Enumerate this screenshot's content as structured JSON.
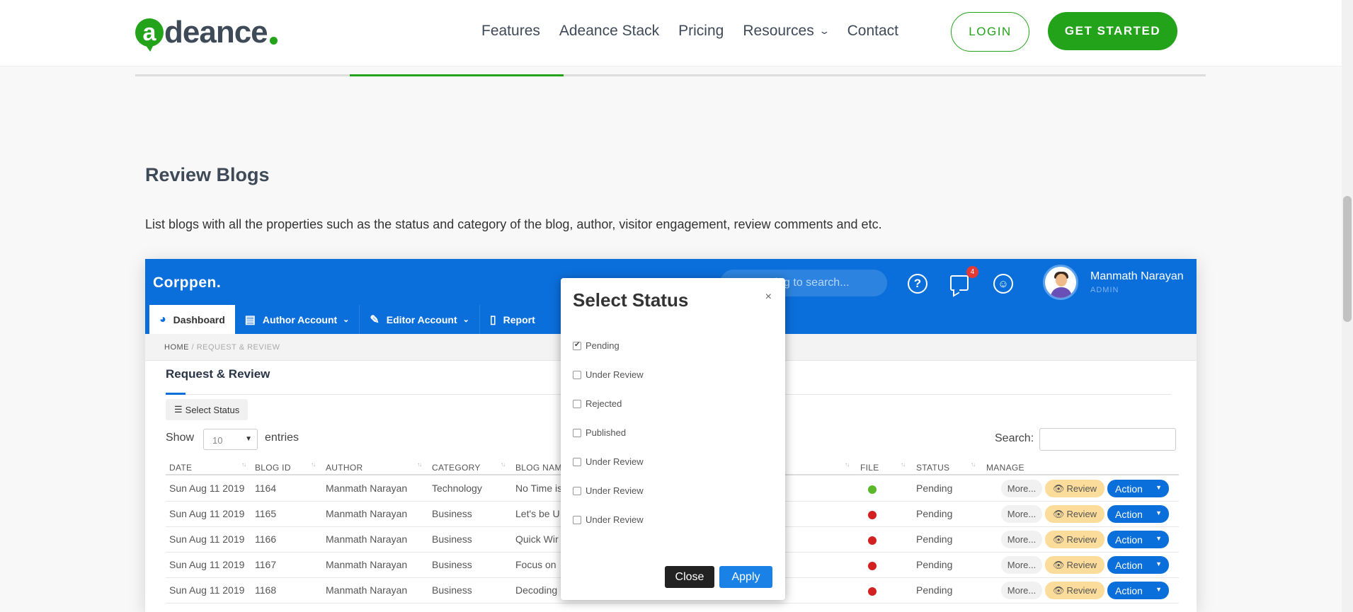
{
  "site": {
    "logo_text": "deance",
    "logo_letter": "a",
    "nav": [
      {
        "label": "Features"
      },
      {
        "label": "Adeance Stack"
      },
      {
        "label": "Pricing"
      },
      {
        "label": "Resources",
        "has_dropdown": true
      },
      {
        "label": "Contact"
      }
    ],
    "login_label": "LOGIN",
    "get_started_label": "GET STARTED",
    "brand_color": "#23a31a"
  },
  "section": {
    "title": "Review Blogs",
    "description": "List blogs with all the properties such as the status and category of the blog, author, visitor engagement, review comments and etc."
  },
  "app": {
    "logo": "Corppen.",
    "search_placeholder": "Start typing to search...",
    "notification_count": "4",
    "user_name": "Manmath Narayan",
    "user_role": "ADMIN",
    "primary_color": "#0b6fdb",
    "tabs": [
      {
        "label": "Dashboard",
        "icon": "dashboard-icon",
        "active": true
      },
      {
        "label": "Author Account",
        "icon": "book-icon",
        "has_dropdown": true
      },
      {
        "label": "Editor Account",
        "icon": "pencil-icon",
        "has_dropdown": true
      },
      {
        "label": "Report",
        "icon": "file-icon"
      }
    ],
    "breadcrumb": {
      "home": "HOME",
      "sep": "/",
      "current": "REQUEST & REVIEW"
    },
    "page_title": "Request & Review",
    "select_status_label": "Select Status",
    "show_label": "Show",
    "show_value": "10",
    "entries_label": "entries",
    "search_label": "Search:",
    "columns": [
      "DATE",
      "BLOG ID",
      "AUTHOR",
      "CATEGORY",
      "BLOG NAM",
      "FILE",
      "STATUS",
      "MANAGE"
    ],
    "rows": [
      {
        "date": "Sun Aug 11 2019",
        "id": "1164",
        "author": "Manmath Narayan",
        "category": "Technology",
        "name": "No Time is",
        "file_status": "green",
        "status": "Pending"
      },
      {
        "date": "Sun Aug 11 2019",
        "id": "1165",
        "author": "Manmath Narayan",
        "category": "Business",
        "name": "Let's be U",
        "file_status": "red",
        "status": "Pending"
      },
      {
        "date": "Sun Aug 11 2019",
        "id": "1166",
        "author": "Manmath Narayan",
        "category": "Business",
        "name": "Quick Wir",
        "file_status": "red",
        "status": "Pending"
      },
      {
        "date": "Sun Aug 11 2019",
        "id": "1167",
        "author": "Manmath Narayan",
        "category": "Business",
        "name": "Focus on",
        "file_status": "red",
        "status": "Pending"
      },
      {
        "date": "Sun Aug 11 2019",
        "id": "1168",
        "author": "Manmath Narayan",
        "category": "Business",
        "name": "Decoding",
        "file_status": "red",
        "status": "Pending"
      }
    ],
    "more_label": "More...",
    "review_label": "Review",
    "action_label": "Action"
  },
  "modal": {
    "title": "Select Status",
    "close_x": "×",
    "options": [
      {
        "label": "Pending",
        "checked": true
      },
      {
        "label": "Under Review",
        "checked": false
      },
      {
        "label": "Rejected",
        "checked": false
      },
      {
        "label": "Published",
        "checked": false
      },
      {
        "label": "Under Review",
        "checked": false
      },
      {
        "label": "Under Review",
        "checked": false
      },
      {
        "label": "Under Review",
        "checked": false
      }
    ],
    "close_label": "Close",
    "apply_label": "Apply"
  }
}
